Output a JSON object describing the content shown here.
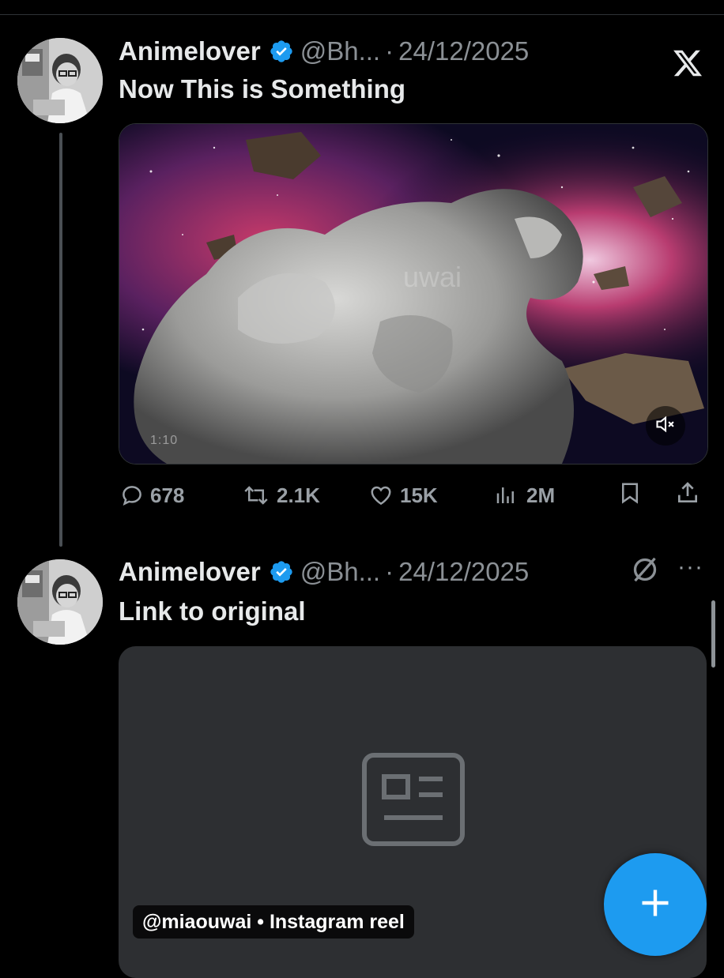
{
  "tweets": [
    {
      "author": "Animelover",
      "handle": "@Bh...",
      "separator": "·",
      "date": "24/12/2025",
      "text": "Now This is Something",
      "media": {
        "watermark": "uwai",
        "time": "1:10"
      },
      "stats": {
        "replies": "678",
        "retweets": "2.1K",
        "likes": "15K",
        "views": "2M"
      }
    },
    {
      "author": "Animelover",
      "handle": "@Bh...",
      "separator": "·",
      "date": "24/12/2025",
      "text": "Link to original",
      "card": {
        "caption": "@miaouwai • Instagram reel"
      }
    }
  ],
  "colors": {
    "background": "#000000",
    "verified_blue": "#1d9bf0",
    "muted_text": "#8b9095",
    "card_bg": "#2d2f32",
    "fab": "#1d9bf0"
  },
  "icons": [
    "x-logo-icon",
    "verified-icon",
    "reply-icon",
    "retweet-icon",
    "like-icon",
    "views-icon",
    "bookmark-icon",
    "share-icon",
    "mute-icon",
    "grok-icon",
    "more-icon",
    "article-icon",
    "plus-icon"
  ]
}
